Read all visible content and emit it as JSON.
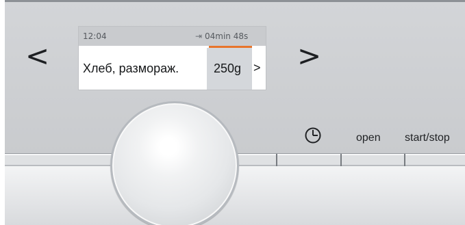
{
  "display": {
    "time": "12:04",
    "remaining": "04min 48s",
    "program": "Хлеб, размораж.",
    "weight": "250g",
    "chevron": ">"
  },
  "navigation": {
    "previous": "<",
    "next": ">"
  },
  "buttons": {
    "open": "open",
    "start_stop": "start/stop"
  },
  "icons": {
    "timer_remaining": "timer-remaining-icon",
    "clock": "clock-icon"
  },
  "colors": {
    "accent": "#e8742a"
  }
}
